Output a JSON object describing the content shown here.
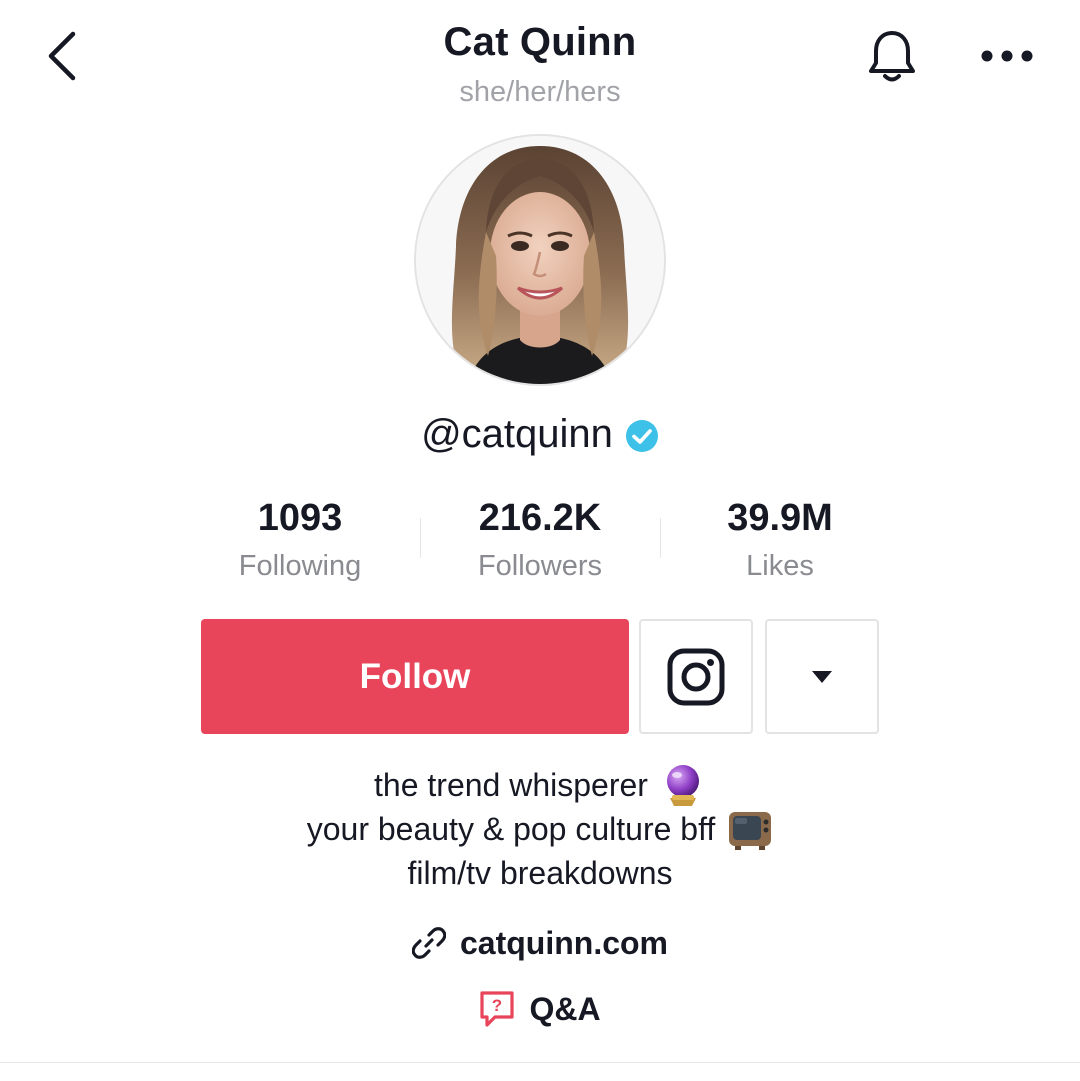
{
  "header": {
    "title": "Cat Quinn",
    "pronouns": "she/her/hers",
    "icons": {
      "back": "chevron-left-icon",
      "notifications": "bell-icon",
      "more": "more-dots-icon"
    }
  },
  "profile": {
    "username": "@catquinn",
    "verified": true,
    "avatar_alt": "profile photo"
  },
  "stats": [
    {
      "value": "1093",
      "label": "Following"
    },
    {
      "value": "216.2K",
      "label": "Followers"
    },
    {
      "value": "39.9M",
      "label": "Likes"
    }
  ],
  "actions": {
    "follow_label": "Follow",
    "instagram_icon": "instagram-icon",
    "dropdown_icon": "caret-down-icon"
  },
  "bio": {
    "lines": [
      {
        "text": "the trend whisperer",
        "emoji": "crystal-ball"
      },
      {
        "text": "your beauty & pop culture bff",
        "emoji": "television"
      },
      {
        "text": "film/tv breakdowns",
        "emoji": ""
      }
    ]
  },
  "link": {
    "text": "catquinn.com",
    "icon": "link-icon"
  },
  "qa": {
    "text": "Q&A",
    "icon": "question-bubble-icon"
  },
  "colors": {
    "accent": "#e8445a",
    "text_primary": "#161823",
    "text_secondary": "#8a8b91",
    "verified": "#3ec1e8",
    "border": "#e3e3e4"
  }
}
